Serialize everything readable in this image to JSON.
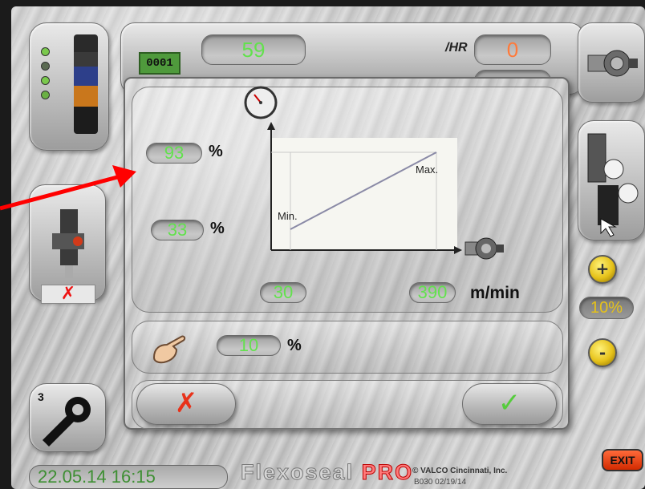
{
  "header": {
    "counter_display": "0001",
    "count_value": "59",
    "rate_label": "/HR",
    "rate_value": "0"
  },
  "dialog": {
    "max_percent": "93",
    "min_percent": "33",
    "percent_unit": "%",
    "graph_min_label": "Min.",
    "graph_max_label": "Max.",
    "min_speed": "30",
    "max_speed": "390",
    "speed_unit": "m/min",
    "step_percent": "10",
    "cancel_icon": "red-x-icon",
    "confirm_icon": "green-check-icon"
  },
  "sidebar_right": {
    "increase_label": "+",
    "decrease_label": "-",
    "step_value": "10%"
  },
  "footer": {
    "menu_number": "3",
    "datetime": "22.05.14 16:15",
    "brand_name": "Flexoseal",
    "brand_suffix": "PRO",
    "copyright": "© VALCO Cincinnati, Inc.",
    "version": "B030 02/19/14",
    "exit_label": "EXIT"
  },
  "colors": {
    "value_green": "#63e14e",
    "chart_line": "#8a8aa6",
    "arrow_red": "#ff0000"
  }
}
